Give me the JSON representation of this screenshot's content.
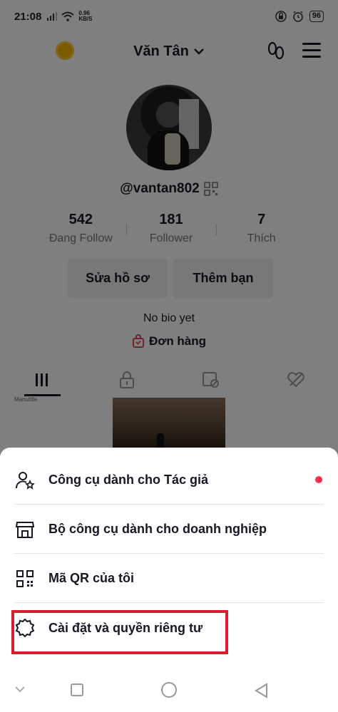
{
  "status": {
    "time": "21:08",
    "speed_value": "0.96",
    "speed_unit": "KB/S",
    "battery": "96"
  },
  "header": {
    "username": "Văn Tân",
    "icons": [
      "coin-icon",
      "footprint-icon",
      "menu-icon"
    ]
  },
  "profile": {
    "handle": "@vantan802",
    "stats": [
      {
        "value": "542",
        "label": "Đang Follow"
      },
      {
        "value": "181",
        "label": "Follower"
      },
      {
        "value": "7",
        "label": "Thích"
      }
    ],
    "edit_button": "Sửa hồ sơ",
    "add_friend_button": "Thêm bạn",
    "bio": "No bio yet",
    "orders": "Đơn hàng"
  },
  "tabs": [
    "videos-tab",
    "private-tab",
    "reposts-tab",
    "liked-tab"
  ],
  "thumb_label": "Manuttlle",
  "menu_sheet": {
    "items": [
      {
        "label": "Công cụ dành cho Tác giả",
        "icon": "creator-tools-icon"
      },
      {
        "label": "Bộ công cụ dành cho doanh nghiệp",
        "icon": "business-store-icon"
      },
      {
        "label": "Mã QR của tôi",
        "icon": "qr-code-icon"
      },
      {
        "label": "Cài đặt và quyền riêng tư",
        "icon": "settings-gear-icon"
      }
    ],
    "notification_color": "#fe2c55",
    "highlight_color": "#d81d33"
  }
}
